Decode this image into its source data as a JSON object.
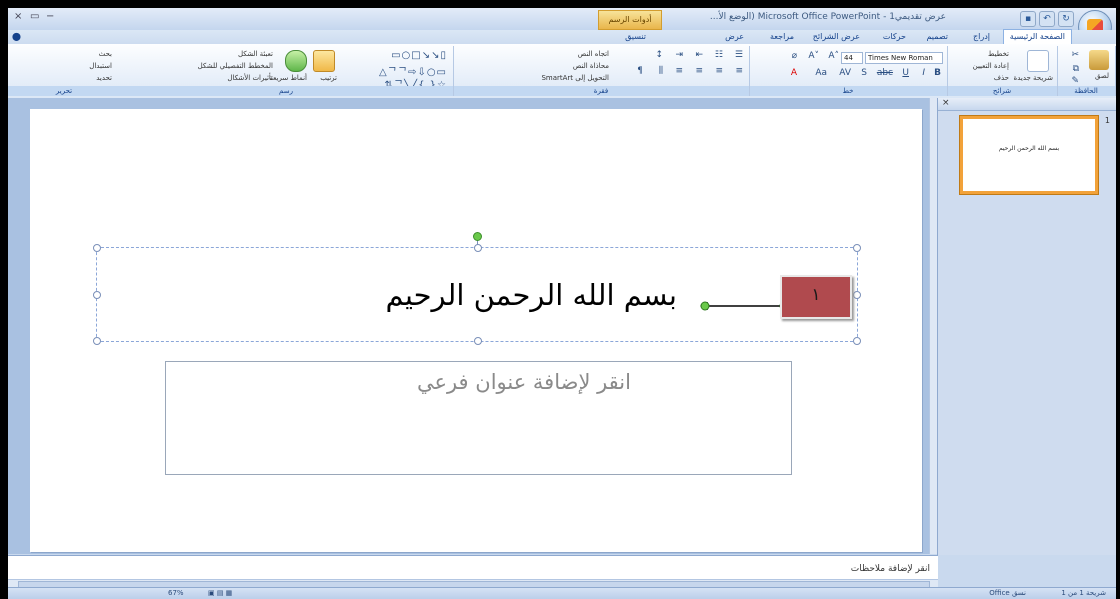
{
  "app": {
    "title": "عرض تقديمي1 - Microsoft Office PowerPoint (الوضع الأ...",
    "context_tab": "أدوات الرسم",
    "window_controls": [
      "×",
      "▭",
      "−"
    ]
  },
  "tabs": [
    {
      "label": "الصفحة الرئيسية",
      "active": true
    },
    {
      "label": "إدراج"
    },
    {
      "label": "تصميم"
    },
    {
      "label": "حركات"
    },
    {
      "label": "عرض الشرائح"
    },
    {
      "label": "مراجعة"
    },
    {
      "label": "عرض"
    },
    {
      "label": "تنسيق"
    }
  ],
  "ribbon": {
    "clipboard": {
      "label": "الحافظة",
      "paste": "لصق"
    },
    "slides": {
      "label": "شرائح",
      "new_slide": "شريحة جديدة",
      "layout": "تخطيط",
      "reset": "إعادة التعيين",
      "delete": "حذف"
    },
    "font": {
      "label": "خط",
      "font_name": "Times New Roman",
      "font_size": "44"
    },
    "paragraph": {
      "label": "فقرة",
      "text_direction": "اتجاه النص",
      "align_text": "محاذاة النص",
      "smartart": "التحويل إلى SmartArt"
    },
    "drawing": {
      "label": "رسم",
      "shape_fill": "تعبئة الشكل",
      "shape_outline": "المخطط التفصيلي للشكل",
      "shape_effects": "تأثيرات الأشكال",
      "arrange": "ترتيب",
      "quick_styles": "أنماط سريعة"
    },
    "editing": {
      "label": "تحرير",
      "find": "بحث",
      "replace": "استبدال",
      "select": "تحديد"
    }
  },
  "slide": {
    "title_text": "بسم الله الرحمن الرحيم",
    "subtitle_placeholder": "انقر لإضافة عنوان فرعي",
    "callout_number": "١"
  },
  "slides_pane": {
    "thumb_number": "1",
    "thumb_text": "بسم الله الرحمن الرحيم",
    "close": "×"
  },
  "notes": {
    "placeholder": "انقر لإضافة ملاحظات"
  },
  "status": {
    "slide_info": "شريحة 1 من 1",
    "theme": "نسق Office",
    "zoom": "67%"
  },
  "colors": {
    "callout_fill": "#b04a4e",
    "selection_thumb": "#f2a23a"
  }
}
